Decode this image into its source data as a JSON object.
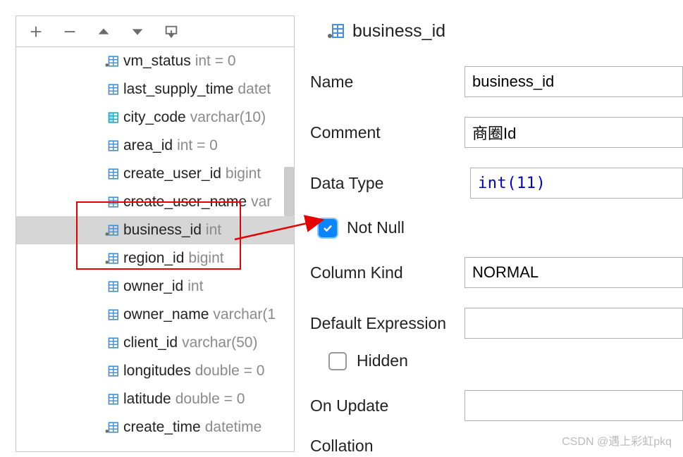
{
  "header": {
    "title": "business_id"
  },
  "columns": [
    {
      "name": "vm_status",
      "type": "int = 0",
      "iconDot": true
    },
    {
      "name": "last_supply_time",
      "type": "datet",
      "iconDot": false
    },
    {
      "name": "city_code",
      "type": "varchar(10)",
      "iconDot": false,
      "cyan": true
    },
    {
      "name": "area_id",
      "type": "int = 0",
      "iconDot": false
    },
    {
      "name": "create_user_id",
      "type": "bigint",
      "iconDot": false
    },
    {
      "name": "create_user_name",
      "type": "var",
      "iconDot": false
    },
    {
      "name": "business_id",
      "type": "int",
      "iconDot": true,
      "selected": true
    },
    {
      "name": "region_id",
      "type": "bigint",
      "iconDot": true
    },
    {
      "name": "owner_id",
      "type": "int",
      "iconDot": false
    },
    {
      "name": "owner_name",
      "type": "varchar(1",
      "iconDot": false
    },
    {
      "name": "client_id",
      "type": "varchar(50)",
      "iconDot": false
    },
    {
      "name": "longitudes",
      "type": "double = 0",
      "iconDot": false
    },
    {
      "name": "latitude",
      "type": "double = 0",
      "iconDot": false
    },
    {
      "name": "create_time",
      "type": "datetime",
      "iconDot": true
    }
  ],
  "form": {
    "name_label": "Name",
    "name_value": "business_id",
    "comment_label": "Comment",
    "comment_value": "商圈Id",
    "datatype_label": "Data Type",
    "datatype_value": "int(11)",
    "notnull_label": "Not Null",
    "columnkind_label": "Column Kind",
    "columnkind_value": "NORMAL",
    "default_label": "Default Expression",
    "default_value": "",
    "hidden_label": "Hidden",
    "onupdate_label": "On Update",
    "onupdate_value": "",
    "collation_label": "Collation"
  },
  "watermark": "CSDN @遇上彩虹pkq"
}
